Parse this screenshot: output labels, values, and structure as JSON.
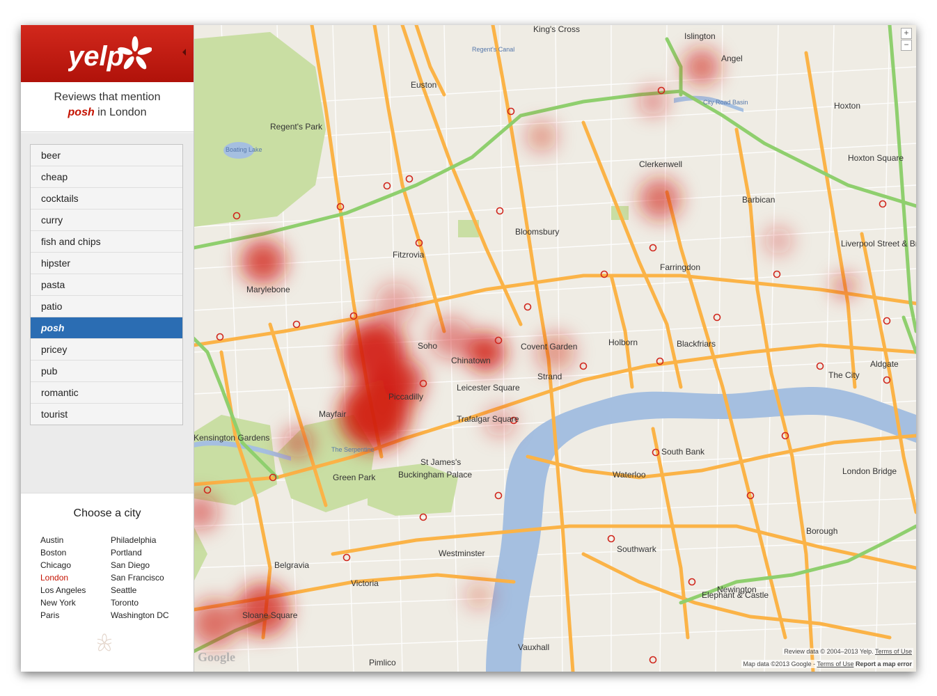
{
  "brand": {
    "name": "yelp"
  },
  "subtitle": {
    "line1": "Reviews that mention",
    "keyword": "posh",
    "suffix": " in London"
  },
  "topics": [
    "beer",
    "cheap",
    "cocktails",
    "curry",
    "fish and chips",
    "hipster",
    "pasta",
    "patio",
    "posh",
    "pricey",
    "pub",
    "romantic",
    "tourist"
  ],
  "active_topic": "posh",
  "cities": {
    "title": "Choose a city",
    "col1": [
      "Austin",
      "Boston",
      "Chicago",
      "London",
      "Los Angeles",
      "New York",
      "Paris"
    ],
    "col2": [
      "Philadelphia",
      "Portland",
      "San Diego",
      "San Francisco",
      "Seattle",
      "Toronto",
      "Washington DC"
    ],
    "active": "London"
  },
  "map": {
    "zoom_in": "+",
    "zoom_out": "−",
    "provider": "Google",
    "review_data": "Review data © 2004–2013 Yelp.",
    "terms": "Terms of Use",
    "map_data": "Map data ©2013 Google -",
    "report": "Report a map error",
    "labels": {
      "kings_cross": "King's Cross",
      "islington": "Islington",
      "angel": "Angel",
      "euston": "Euston",
      "regents_park": "Regent's Park",
      "hoxton": "Hoxton",
      "hoxton_square": "Hoxton Square",
      "clerkenwell": "Clerkenwell",
      "barbican": "Barbican",
      "bloomsbury": "Bloomsbury",
      "fitzrovia": "Fitzrovia",
      "marylebone": "Marylebone",
      "farringdon": "Farringdon",
      "liverpool_street": "Liverpool Street & Broadgate",
      "soho": "Soho",
      "covent_garden": "Covent Garden",
      "holborn": "Holborn",
      "blackfriars": "Blackfriars",
      "chinatown": "Chinatown",
      "the_city": "The City",
      "aldgate": "Aldgate",
      "strand": "Strand",
      "leicester_square": "Leicester Square",
      "trafalgar_square": "Trafalgar Square",
      "piccadilly": "Piccadilly",
      "mayfair": "Mayfair",
      "south_bank": "South Bank",
      "london_bridge": "London Bridge",
      "st_james": "St James's",
      "buckingham_palace": "Buckingham Palace",
      "green_park": "Green Park",
      "waterloo": "Waterloo",
      "kensington_gardens": "Kensington Gardens",
      "borough": "Borough",
      "westminster": "Westminster",
      "southwark": "Southwark",
      "belgravia": "Belgravia",
      "victoria": "Victoria",
      "newington": "Newington",
      "elephant_castle": "Elephant & Castle",
      "sloane_square": "Sloane Square",
      "vauxhall": "Vauxhall",
      "pimlico": "Pimlico",
      "boating_lake": "Boating Lake",
      "the_serpentine": "The Serpentine",
      "city_road_basin": "City Road Basin",
      "regents_canal": "Regent's Canal"
    }
  },
  "colors": {
    "brand_red": "#c41200",
    "active_topic_bg": "#2b6db3",
    "road_major": "#fbb347",
    "road_green": "#8fcf6e",
    "river": "#a5bfe0",
    "park": "#c9dea3",
    "heat": "#d01a10"
  }
}
